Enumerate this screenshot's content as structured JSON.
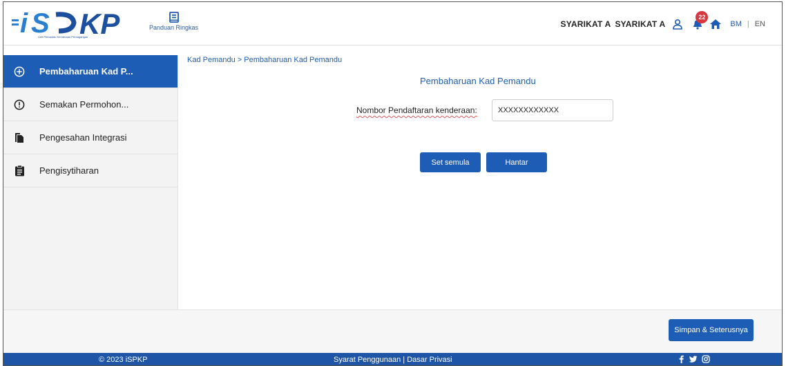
{
  "header": {
    "logo_text": "iSPKP",
    "logo_caption": "Unit Pemantau Kenderaan Perdagangan",
    "guide_label": "Panduan Ringkas",
    "company_1": "SYARIKAT A",
    "company_2": "SYARIKAT A",
    "notification_count": "22",
    "lang_bm": "BM",
    "lang_sep": "|",
    "lang_en": "EN",
    "icons": [
      "book-icon",
      "user-icon",
      "bell-icon",
      "home-icon"
    ]
  },
  "sidebar": {
    "items": [
      {
        "label": "Pembaharuan Kad P...",
        "icon": "plus-circle-icon",
        "active": true
      },
      {
        "label": "Semakan Permohon...",
        "icon": "alert-circle-icon",
        "active": false
      },
      {
        "label": "Pengesahan Integrasi",
        "icon": "documents-icon",
        "active": false
      },
      {
        "label": "Pengisytiharan",
        "icon": "clipboard-icon",
        "active": false
      }
    ]
  },
  "main": {
    "breadcrumb": "Kad Pemandu > Pembaharuan Kad Pemandu",
    "title": "Pembaharuan Kad Pemandu",
    "field_label": "Nombor Pendaftaran kenderaan:",
    "field_value": "XXXXXXXXXXXX",
    "reset_label": "Set semula",
    "submit_label": "Hantar"
  },
  "bottom": {
    "next_label": "Simpan & Seterusnya"
  },
  "footer": {
    "copyright": "© 2023 iSPKP",
    "links": "Syarat Penggunaan | Dasar Privasi",
    "social": [
      "facebook-icon",
      "twitter-icon",
      "instagram-icon"
    ]
  },
  "colors": {
    "primary": "#1e5db5",
    "footer": "#1f55a6",
    "badge": "#d9363e"
  }
}
